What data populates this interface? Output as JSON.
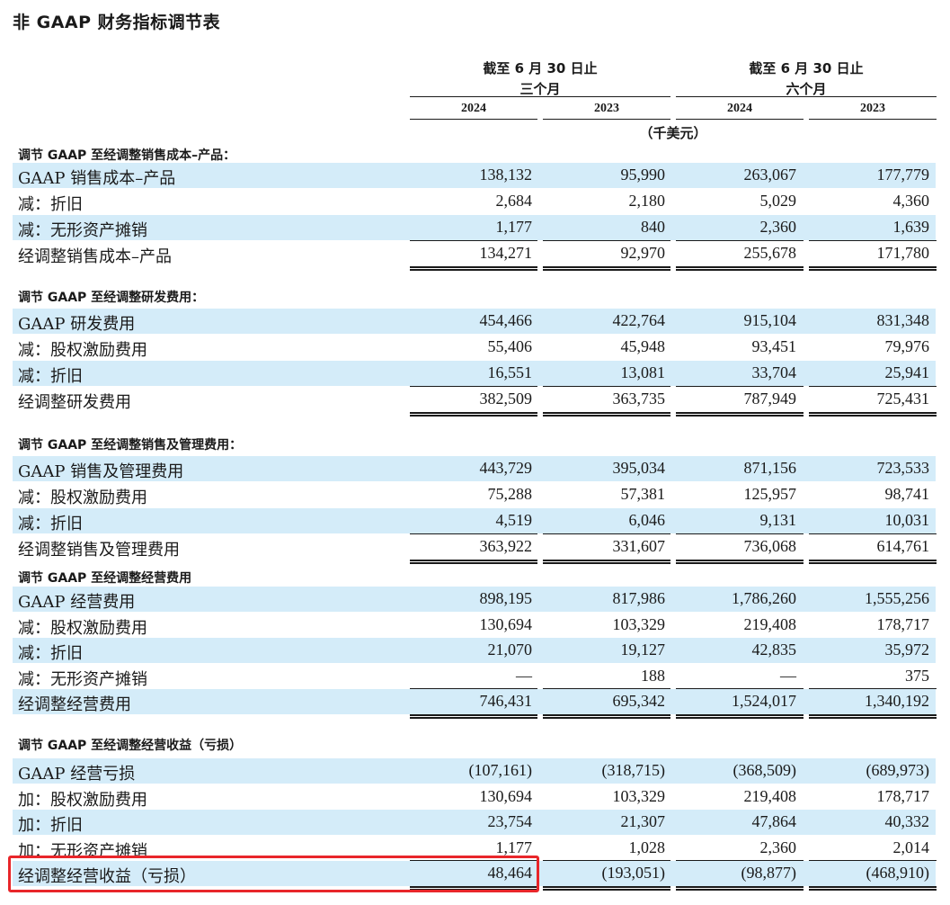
{
  "title": "非 GAAP 财务指标调节表",
  "header": {
    "period_prefix": "截至 6 月 30 日止",
    "three_months": "三个月",
    "six_months": "六个月",
    "years": [
      "2024",
      "2023",
      "2024",
      "2023"
    ],
    "unit": "（千美元）"
  },
  "sections": [
    {
      "title": "调节 GAAP 至经调整销售成本–产品：",
      "rows": [
        {
          "label": "GAAP 销售成本–产品",
          "values": [
            "138,132",
            "95,990",
            "263,067",
            "177,779"
          ]
        },
        {
          "label": "减：折旧",
          "values": [
            "2,684",
            "2,180",
            "5,029",
            "4,360"
          ]
        },
        {
          "label": "减：无形资产摊销",
          "values": [
            "1,177",
            "840",
            "2,360",
            "1,639"
          ]
        },
        {
          "label": "经调整销售成本–产品",
          "values": [
            "134,271",
            "92,970",
            "255,678",
            "171,780"
          ]
        }
      ]
    },
    {
      "title": "调节 GAAP 至经调整研发费用：",
      "rows": [
        {
          "label": "GAAP 研发费用",
          "values": [
            "454,466",
            "422,764",
            "915,104",
            "831,348"
          ]
        },
        {
          "label": "减：股权激励费用",
          "values": [
            "55,406",
            "45,948",
            "93,451",
            "79,976"
          ]
        },
        {
          "label": "减：折旧",
          "values": [
            "16,551",
            "13,081",
            "33,704",
            "25,941"
          ]
        },
        {
          "label": "经调整研发费用",
          "values": [
            "382,509",
            "363,735",
            "787,949",
            "725,431"
          ]
        }
      ]
    },
    {
      "title": "调节 GAAP 至经调整销售及管理费用：",
      "rows": [
        {
          "label": "GAAP 销售及管理费用",
          "values": [
            "443,729",
            "395,034",
            "871,156",
            "723,533"
          ]
        },
        {
          "label": "减：股权激励费用",
          "values": [
            "75,288",
            "57,381",
            "125,957",
            "98,741"
          ]
        },
        {
          "label": "减：折旧",
          "values": [
            "4,519",
            "6,046",
            "9,131",
            "10,031"
          ]
        },
        {
          "label": "经调整销售及管理费用",
          "values": [
            "363,922",
            "331,607",
            "736,068",
            "614,761"
          ]
        }
      ]
    },
    {
      "title": "调节 GAAP 至经调整经营费用",
      "rows": [
        {
          "label": "GAAP 经营费用",
          "values": [
            "898,195",
            "817,986",
            "1,786,260",
            "1,555,256"
          ]
        },
        {
          "label": "减：股权激励费用",
          "values": [
            "130,694",
            "103,329",
            "219,408",
            "178,717"
          ]
        },
        {
          "label": "减：折旧",
          "values": [
            "21,070",
            "19,127",
            "42,835",
            "35,972"
          ]
        },
        {
          "label": "减：无形资产摊销",
          "values": [
            "—",
            "188",
            "—",
            "375"
          ]
        },
        {
          "label": "经调整经营费用",
          "values": [
            "746,431",
            "695,342",
            "1,524,017",
            "1,340,192"
          ]
        }
      ]
    },
    {
      "title": "调节 GAAP 至经调整经营收益（亏损）",
      "rows": [
        {
          "label": "GAAP 经营亏损",
          "values": [
            "(107,161)",
            "(318,715)",
            "(368,509)",
            "(689,973)"
          ]
        },
        {
          "label": "加：股权激励费用",
          "values": [
            "130,694",
            "103,329",
            "219,408",
            "178,717"
          ]
        },
        {
          "label": "加：折旧",
          "values": [
            "23,754",
            "21,307",
            "47,864",
            "40,332"
          ]
        },
        {
          "label": "加：无形资产摊销",
          "values": [
            "1,177",
            "1,028",
            "2,360",
            "2,014"
          ]
        },
        {
          "label": "经调整经营收益（亏损）",
          "values": [
            "48,464",
            "(193,051)",
            "(98,877)",
            "(468,910)"
          ]
        }
      ]
    }
  ]
}
